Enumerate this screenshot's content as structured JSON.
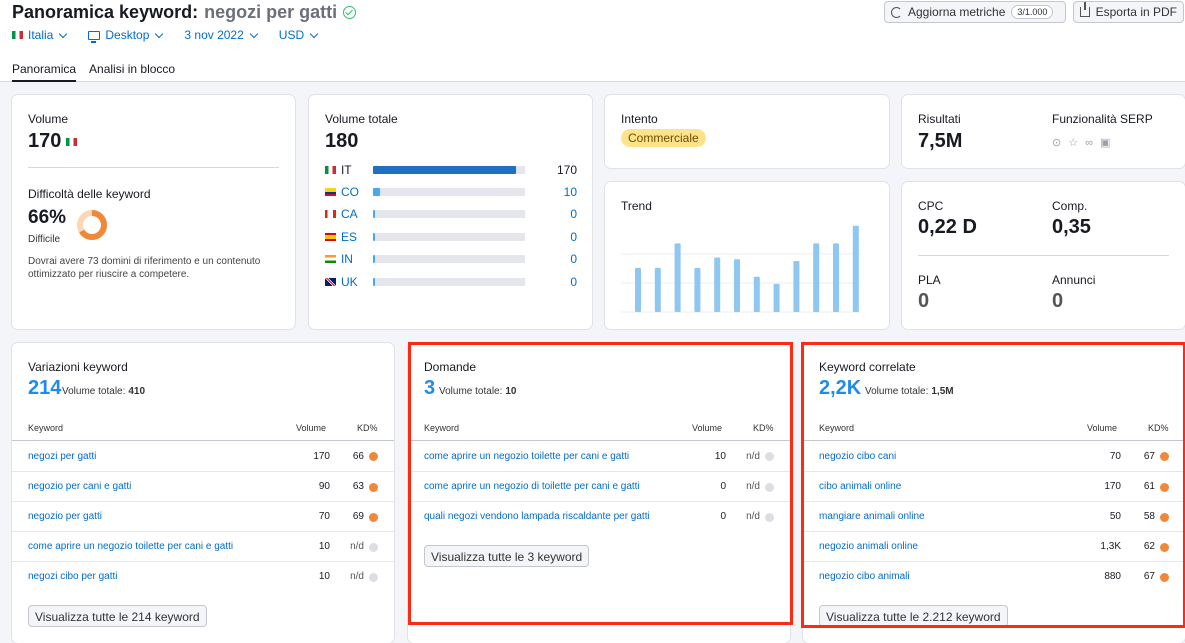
{
  "header": {
    "title_prefix": "Panoramica keyword:",
    "keyword": "negozi per gatti",
    "country": "Italia",
    "device": "Desktop",
    "date": "3 nov 2022",
    "currency": "USD",
    "update_label": "Aggiorna metriche",
    "update_count": "3/1.000",
    "export_label": "Esporta in PDF",
    "tabs": [
      "Panoramica",
      "Analisi in blocco"
    ]
  },
  "volume": {
    "label": "Volume",
    "value": "170",
    "difficulty_label": "Difficoltà delle keyword",
    "difficulty_value": "66%",
    "difficulty_level": "Difficile",
    "difficulty_fraction": 0.66,
    "difficulty_text": "Dovrai avere 73 domini di riferimento e un contenuto ottimizzato per riuscire a competere."
  },
  "total_volume": {
    "label": "Volume totale",
    "value": "180",
    "countries": [
      {
        "code": "IT",
        "value": "170",
        "fraction": 0.94
      },
      {
        "code": "CO",
        "value": "10",
        "fraction": 0.05
      },
      {
        "code": "CA",
        "value": "0",
        "fraction": 0.0
      },
      {
        "code": "ES",
        "value": "0",
        "fraction": 0.0
      },
      {
        "code": "IN",
        "value": "0",
        "fraction": 0.0
      },
      {
        "code": "UK",
        "value": "0",
        "fraction": 0.0
      }
    ]
  },
  "intent": {
    "label": "Intento",
    "value": "Commerciale"
  },
  "trend": {
    "label": "Trend",
    "values": [
      0.5,
      0.5,
      0.78,
      0.5,
      0.62,
      0.6,
      0.4,
      0.32,
      0.58,
      0.78,
      0.78,
      0.98
    ]
  },
  "results": {
    "label": "Risultati",
    "value": "7,5M",
    "serp_label": "Funzionalità SERP"
  },
  "cpc": {
    "cpc_label": "CPC",
    "cpc_value": "0,22 D",
    "comp_label": "Comp.",
    "comp_value": "0,35",
    "pla_label": "PLA",
    "pla_value": "0",
    "ads_label": "Annunci",
    "ads_value": "0"
  },
  "variations": {
    "title": "Variazioni keyword",
    "count": "214",
    "total_label": "Volume totale:",
    "total_value": "410",
    "col_keyword": "Keyword",
    "col_volume": "Volume",
    "col_kd": "KD%",
    "rows": [
      {
        "keyword": "negozi per gatti",
        "volume": "170",
        "kd": "66",
        "color": "#f0883a"
      },
      {
        "keyword": "negozio per cani e gatti",
        "volume": "90",
        "kd": "63",
        "color": "#f0883a"
      },
      {
        "keyword": "negozio per gatti",
        "volume": "70",
        "kd": "69",
        "color": "#f0883a"
      },
      {
        "keyword": "come aprire un negozio toilette per cani e gatti",
        "volume": "10",
        "kd": "n/d",
        "color": "#dcdee4"
      },
      {
        "keyword": "negozi cibo per gatti",
        "volume": "10",
        "kd": "n/d",
        "color": "#dcdee4"
      }
    ],
    "button": "Visualizza tutte le 214 keyword"
  },
  "questions": {
    "title": "Domande",
    "count": "3",
    "total_label": "Volume totale:",
    "total_value": "10",
    "col_keyword": "Keyword",
    "col_volume": "Volume",
    "col_kd": "KD%",
    "rows": [
      {
        "keyword": "come aprire un negozio toilette per cani e gatti",
        "volume": "10",
        "kd": "n/d",
        "color": "#dcdee4"
      },
      {
        "keyword": "come aprire un negozio di toilette per cani e gatti",
        "volume": "0",
        "kd": "n/d",
        "color": "#dcdee4"
      },
      {
        "keyword": "quali negozi vendono lampada riscaldante per gatti",
        "volume": "0",
        "kd": "n/d",
        "color": "#dcdee4"
      }
    ],
    "button": "Visualizza tutte le 3 keyword"
  },
  "related": {
    "title": "Keyword correlate",
    "count": "2,2K",
    "total_label": "Volume totale:",
    "total_value": "1,5M",
    "col_keyword": "Keyword",
    "col_volume": "Volume",
    "col_kd": "KD%",
    "rows": [
      {
        "keyword": "negozio cibo cani",
        "volume": "70",
        "kd": "67",
        "color": "#f0883a"
      },
      {
        "keyword": "cibo animali online",
        "volume": "170",
        "kd": "61",
        "color": "#f0883a"
      },
      {
        "keyword": "mangiare animali online",
        "volume": "50",
        "kd": "58",
        "color": "#f0883a"
      },
      {
        "keyword": "negozio animali online",
        "volume": "1,3K",
        "kd": "62",
        "color": "#f0883a"
      },
      {
        "keyword": "negozio cibo animali",
        "volume": "880",
        "kd": "67",
        "color": "#f0883a"
      }
    ],
    "button": "Visualizza tutte le 2.212 keyword"
  }
}
